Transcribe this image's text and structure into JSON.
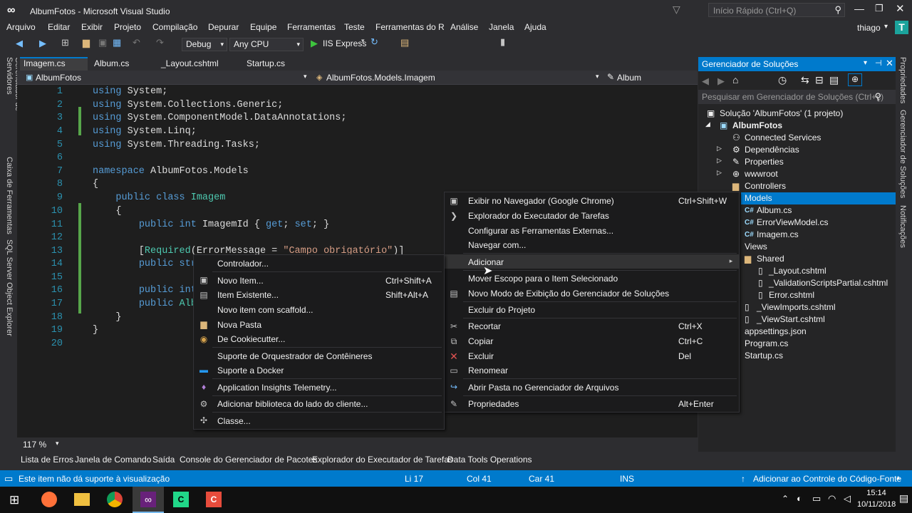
{
  "window": {
    "title": "AlbumFotos - Microsoft Visual Studio",
    "quick_launch_placeholder": "Início Rápido (Ctrl+Q)",
    "user": "thiago",
    "user_initial": "T"
  },
  "menu": [
    "Arquivo",
    "Editar",
    "Exibir",
    "Projeto",
    "Compilação",
    "Depurar",
    "Equipe",
    "Ferramentas",
    "Teste",
    "Ferramentas do R",
    "Análise",
    "Janela",
    "Ajuda"
  ],
  "toolbar": {
    "config": "Debug",
    "platform": "Any CPU",
    "run_label": "IIS Express"
  },
  "left_strip": [
    "Gerenciador de Servidores",
    "Caixa de Ferramentas",
    "SQL Server Object Explorer"
  ],
  "right_strip": [
    "Propriedades",
    "Gerenciador de Soluções",
    "Notificações"
  ],
  "tabs": [
    "Imagem.cs",
    "Album.cs",
    "_Layout.cshtml",
    "Startup.cs"
  ],
  "navbar": {
    "project": "AlbumFotos",
    "type": "AlbumFotos.Models.Imagem",
    "member": "Album"
  },
  "code_lines": [
    "1",
    "2",
    "3",
    "4",
    "5",
    "6",
    "7",
    "8",
    "9",
    "10",
    "11",
    "12",
    "13",
    "14",
    "15",
    "16",
    "17",
    "18",
    "19",
    "20"
  ],
  "zoom": "117 %",
  "solution_explorer": {
    "title": "Gerenciador de Soluções",
    "search_placeholder": "Pesquisar em Gerenciador de Soluções (Ctrl+ç)",
    "items": [
      "Solução 'AlbumFotos' (1 projeto)",
      "AlbumFotos",
      "Connected Services",
      "Dependências",
      "Properties",
      "wwwroot",
      "Controllers",
      "Models",
      "Album.cs",
      "ErrorViewModel.cs",
      "Imagem.cs",
      "Views",
      "Shared",
      "_Layout.cshtml",
      "_ValidationScriptsPartial.cshtml",
      "Error.cshtml",
      "_ViewImports.cshtml",
      "_ViewStart.cshtml",
      "appsettings.json",
      "Program.cs",
      "Startup.cs"
    ]
  },
  "context_menu": {
    "items": [
      {
        "label": "Exibir no Navegador (Google Chrome)",
        "shortcut": "Ctrl+Shift+W"
      },
      {
        "label": "Explorador do Executador de Tarefas",
        "shortcut": ""
      },
      {
        "label": "Configurar as Ferramentas Externas...",
        "shortcut": ""
      },
      {
        "label": "Navegar com...",
        "shortcut": ""
      },
      {
        "label": "Adicionar",
        "shortcut": ""
      },
      {
        "label": "Mover Escopo para o Item Selecionado",
        "shortcut": ""
      },
      {
        "label": "Novo Modo de Exibição do Gerenciador de Soluções",
        "shortcut": ""
      },
      {
        "label": "Excluir do Projeto",
        "shortcut": ""
      },
      {
        "label": "Recortar",
        "shortcut": "Ctrl+X"
      },
      {
        "label": "Copiar",
        "shortcut": "Ctrl+C"
      },
      {
        "label": "Excluir",
        "shortcut": "Del"
      },
      {
        "label": "Renomear",
        "shortcut": ""
      },
      {
        "label": "Abrir Pasta no Gerenciador de Arquivos",
        "shortcut": ""
      },
      {
        "label": "Propriedades",
        "shortcut": "Alt+Enter"
      }
    ]
  },
  "submenu": {
    "items": [
      {
        "label": "Controlador...",
        "shortcut": ""
      },
      {
        "label": "Novo Item...",
        "shortcut": "Ctrl+Shift+A"
      },
      {
        "label": "Item Existente...",
        "shortcut": "Shift+Alt+A"
      },
      {
        "label": "Novo item com scaffold...",
        "shortcut": ""
      },
      {
        "label": "Nova Pasta",
        "shortcut": ""
      },
      {
        "label": "De Cookiecutter...",
        "shortcut": ""
      },
      {
        "label": "Suporte de Orquestrador de Contêineres",
        "shortcut": ""
      },
      {
        "label": "Suporte a Docker",
        "shortcut": ""
      },
      {
        "label": "Application Insights Telemetry...",
        "shortcut": ""
      },
      {
        "label": "Adicionar biblioteca do lado do cliente...",
        "shortcut": ""
      },
      {
        "label": "Classe...",
        "shortcut": ""
      }
    ]
  },
  "bottom_tabs": [
    "Lista de Erros",
    "Janela de Comando",
    "Saída",
    "Console do Gerenciador de Pacotes",
    "Explorador do Executador de Tarefas",
    "Data Tools Operations"
  ],
  "status": {
    "message": "Este item não dá suporte à visualização",
    "line": "Li 17",
    "col": "Col 41",
    "car": "Car 41",
    "ins": "INS",
    "source_control": "Adicionar ao Controle do Código-Fonte"
  },
  "clock": {
    "time": "15:14",
    "date": "10/11/2018"
  },
  "colors": {
    "accent": "#007acc",
    "editor_bg": "#1e1e1e",
    "keyword": "#569cd6",
    "type": "#4ec9b0",
    "string": "#d69d85"
  }
}
